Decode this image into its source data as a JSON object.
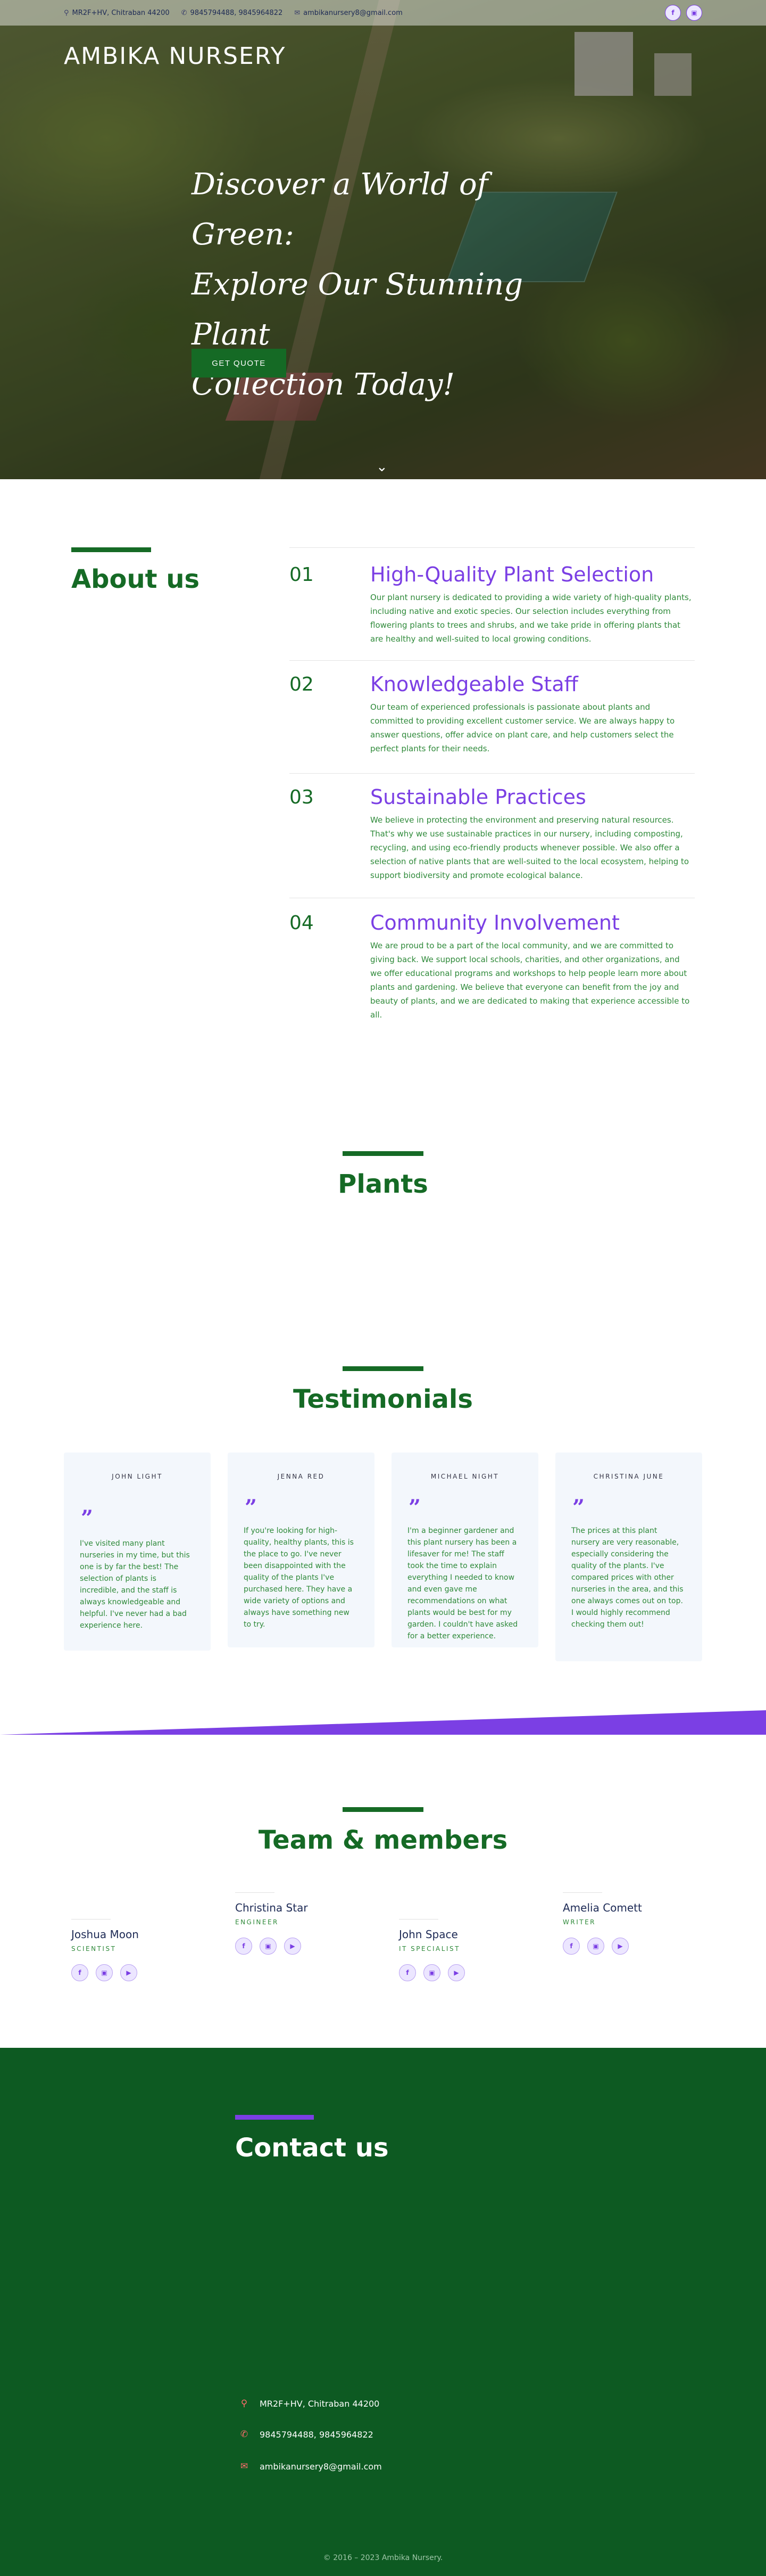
{
  "topbar": {
    "address": "MR2F+HV, Chitraban 44200",
    "phone": "9845794488, 9845964822",
    "email": "ambikanursery8@gmail.com",
    "social_icons": [
      "facebook-icon",
      "instagram-icon"
    ]
  },
  "hero": {
    "brand": "AMBIKA NURSERY",
    "title_line1": "Discover a World of Green:",
    "title_line2": "Explore Our Stunning Plant",
    "title_line3": "Collection Today!",
    "cta": "GET QUOTE"
  },
  "about": {
    "title": "About us",
    "items": [
      {
        "number": "01",
        "heading": "High-Quality Plant Selection",
        "text": "Our plant nursery is dedicated to providing a wide variety of high-quality plants, including native and exotic species. Our selection includes everything from flowering plants to trees and shrubs, and we take pride in offering plants that are healthy and well-suited to local growing conditions."
      },
      {
        "number": "02",
        "heading": "Knowledgeable Staff",
        "text": "Our team of experienced professionals is passionate about plants and committed to providing excellent customer service. We are always happy to answer questions, offer advice on plant care, and help customers select the perfect plants for their needs."
      },
      {
        "number": "03",
        "heading": "Sustainable Practices",
        "text": "We believe in protecting the environment and preserving natural resources. That's why we use sustainable practices in our nursery, including composting, recycling, and using eco-friendly products whenever possible. We also offer a selection of native plants that are well-suited to the local ecosystem, helping to support biodiversity and promote ecological balance."
      },
      {
        "number": "04",
        "heading": "Community Involvement",
        "text": "We are proud to be a part of the local community, and we are committed to giving back. We support local schools, charities, and other organizations, and we offer educational programs and workshops to help people learn more about plants and gardening. We believe that everyone can benefit from the joy and beauty of plants, and we are dedicated to making that experience accessible to all."
      }
    ]
  },
  "plants": {
    "title": "Plants"
  },
  "testimonials": {
    "title": "Testimonials",
    "items": [
      {
        "name": "JOHN LIGHT",
        "text": "I've visited many plant nurseries in my time, but this one is by far the best! The selection of plants is incredible, and the staff is always knowledgeable and helpful. I've never had a bad experience here."
      },
      {
        "name": "JENNA RED",
        "text": "If you're looking for high-quality, healthy plants, this is the place to go. I've never been disappointed with the quality of the plants I've purchased here. They have a wide variety of options and always have something new to try."
      },
      {
        "name": "MICHAEL NIGHT",
        "text": "I'm a beginner gardener and this plant nursery has been a lifesaver for me! The staff took the time to explain everything I needed to know and even gave me recommendations on what plants would be best for my garden. I couldn't have asked for a better experience."
      },
      {
        "name": "CHRISTINA JUNE",
        "text": "The prices at this plant nursery are very reasonable, especially considering the quality of the plants. I've compared prices with other nurseries in the area, and this one always comes out on top. I would highly recommend checking them out!"
      }
    ]
  },
  "team": {
    "title": "Team & members",
    "members": [
      {
        "name": "Joshua Moon",
        "role": "SCIENTIST"
      },
      {
        "name": "Christina Star",
        "role": "ENGINEER"
      },
      {
        "name": "John Space",
        "role": "IT SPECIALIST"
      },
      {
        "name": "Amelia Comett",
        "role": "WRITER"
      }
    ],
    "social_icons": [
      "facebook-icon",
      "instagram-icon",
      "youtube-icon"
    ]
  },
  "contact": {
    "title": "Contact us",
    "address": "MR2F+HV, Chitraban 44200",
    "phone": "9845794488, 9845964822",
    "email": "ambikanursery8@gmail.com",
    "copyright": "© 2016 – 2023 Ambika Nursery."
  },
  "colors": {
    "primary_green": "#156a25",
    "accent_purple": "#7b3fe4",
    "contact_bg": "#0d5a22",
    "icon_red": "#ff6b6b"
  }
}
